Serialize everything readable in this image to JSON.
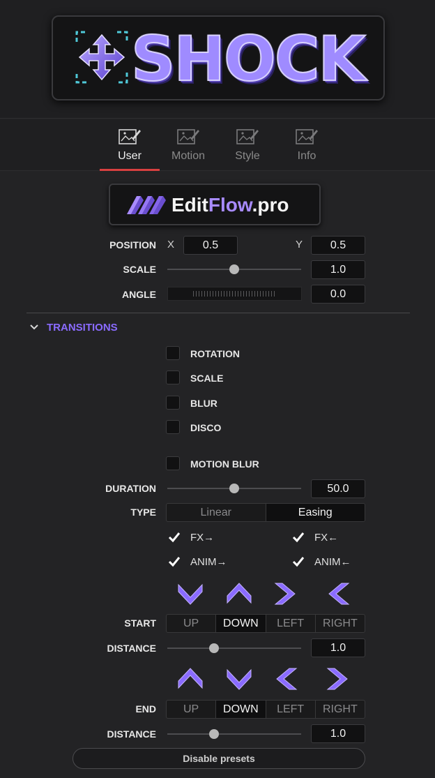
{
  "logo": {
    "text": "SHOCK",
    "icon": "move-arrows-icon"
  },
  "tabs": [
    {
      "label": "User",
      "icon": "edit-image-icon",
      "active": true
    },
    {
      "label": "Motion",
      "icon": "edit-image-icon",
      "active": false
    },
    {
      "label": "Style",
      "icon": "edit-image-icon",
      "active": false
    },
    {
      "label": "Info",
      "icon": "edit-image-icon",
      "active": false
    }
  ],
  "brand": {
    "name_a": "Edit",
    "name_b": "Flow",
    "name_c": ".pro",
    "icon": "editflow-logo-icon"
  },
  "position": {
    "label": "POSITION",
    "x_label": "X",
    "x": "0.5",
    "y_label": "Y",
    "y": "0.5"
  },
  "scale": {
    "label": "SCALE",
    "value": "1.0",
    "slider_fraction": 0.5
  },
  "angle": {
    "label": "ANGLE",
    "value": "0.0"
  },
  "transitions": {
    "title": "TRANSITIONS",
    "checkboxes": [
      {
        "label": "ROTATION",
        "checked": false
      },
      {
        "label": "SCALE",
        "checked": false
      },
      {
        "label": "BLUR",
        "checked": false
      },
      {
        "label": "DISCO",
        "checked": false
      }
    ],
    "motion_blur": {
      "label": "MOTION BLUR",
      "checked": false
    },
    "duration": {
      "label": "DURATION",
      "value": "50.0",
      "slider_fraction": 0.5
    },
    "type": {
      "label": "TYPE",
      "options": [
        "Linear",
        "Easing"
      ],
      "selected": "Easing"
    },
    "fx_in": {
      "label": "FX→",
      "checked": true
    },
    "fx_out": {
      "label": "FX←",
      "checked": true
    },
    "anim_in": {
      "label": "ANIM→",
      "checked": true
    },
    "anim_out": {
      "label": "ANIM←",
      "checked": true
    },
    "start": {
      "label": "START",
      "arrows": [
        "chevron-down-icon",
        "chevron-up-icon",
        "chevron-right-icon",
        "chevron-left-icon"
      ],
      "options": [
        "UP",
        "DOWN",
        "LEFT",
        "RIGHT"
      ],
      "selected": "DOWN",
      "distance_label": "DISTANCE",
      "distance": "1.0",
      "distance_fraction": 0.35
    },
    "end": {
      "label": "END",
      "arrows": [
        "chevron-up-icon",
        "chevron-down-icon",
        "chevron-left-icon",
        "chevron-right-icon"
      ],
      "options": [
        "UP",
        "DOWN",
        "LEFT",
        "RIGHT"
      ],
      "selected": "DOWN",
      "distance_label": "DISTANCE",
      "distance": "1.0",
      "distance_fraction": 0.35
    }
  },
  "disable_presets": "Disable presets",
  "colors": {
    "accent": "#8a6bff",
    "tab_active": "#d84040",
    "background": "#232325"
  }
}
